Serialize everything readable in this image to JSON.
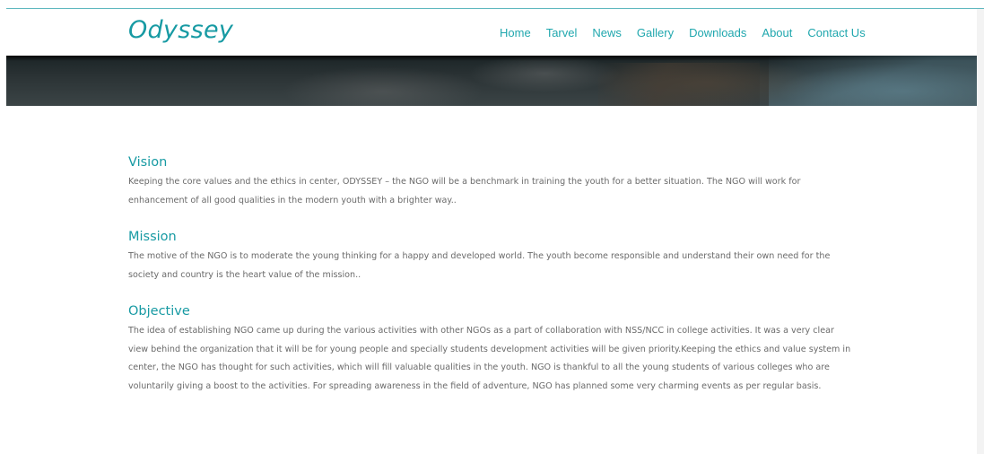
{
  "header": {
    "logo": "Odyssey",
    "nav": [
      "Home",
      "Tarvel",
      "News",
      "Gallery",
      "Downloads",
      "About",
      "Contact Us"
    ]
  },
  "colors": {
    "accent": "#179aa3",
    "nav_text": "#20a7ae",
    "body_text": "#6a6a6a"
  },
  "sections": {
    "vision": {
      "title": "Vision",
      "text": "Keeping the core values and the ethics in center, ODYSSEY – the NGO will be a benchmark in training the youth for a better situation. The NGO will work for enhancement of all good qualities in the modern youth with a brighter way.."
    },
    "mission": {
      "title": "Mission",
      "text": "The motive of the NGO is to moderate the young thinking for a happy and developed world. The youth become responsible and understand their own need for the society and country is the heart value of the mission.."
    },
    "objective": {
      "title": "Objective",
      "text": "The idea of establishing NGO came up during the various activities with other NGOs as a part of collaboration with NSS/NCC in college activities. It was a very clear view behind the organization that it will be for young people and specially students development activities will be given priority.Keeping the ethics and value system in center, the NGO has thought for such activities, which will fill valuable qualities in the youth. NGO is thankful to all the young students of various colleges who are voluntarily giving a boost to the activities. For spreading awareness in the field of adventure, NGO has planned some very charming events as per regular basis."
    }
  }
}
